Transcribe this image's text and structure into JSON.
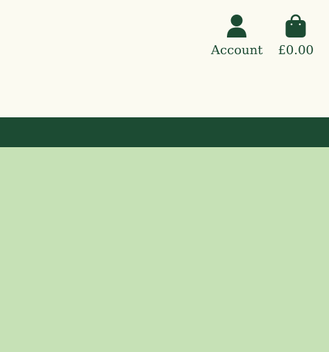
{
  "colors": {
    "header_bg": "#fbfaf1",
    "nav_bg": "#1c4b33",
    "content_bg": "#c6e1b6",
    "icon": "#1c4b33",
    "text": "#1c4b33"
  },
  "header": {
    "account": {
      "icon": "user-icon",
      "label": "Account"
    },
    "basket": {
      "icon": "shopping-bag-icon",
      "total": "£0.00"
    }
  }
}
